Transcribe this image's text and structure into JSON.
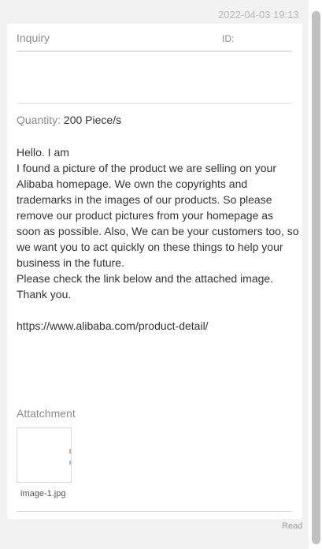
{
  "timestamp": "2022-04-03 19:13",
  "inquiry": {
    "title": "Inquiry",
    "id_label": "ID:"
  },
  "quantity": {
    "label": "Quantity:",
    "value": "200 Piece/s"
  },
  "message": {
    "lines": [
      "Hello. I am",
      "I found a picture of the product we are selling on your",
      "Alibaba homepage. We own the copyrights and",
      "trademarks in the images of our products. So please",
      "remove our product pictures from your homepage as",
      "soon as possible. Also, We can be your customers too, so",
      "we want you to act quickly on these things to help your",
      "business in the future.",
      "Please check the link below and the attached image.",
      "Thank you.",
      "",
      "https://www.alibaba.com/product-detail/"
    ]
  },
  "attachment": {
    "label": "Attatchment",
    "files": [
      {
        "name": "image-1.jpg"
      }
    ]
  },
  "status": {
    "read": "Read"
  }
}
